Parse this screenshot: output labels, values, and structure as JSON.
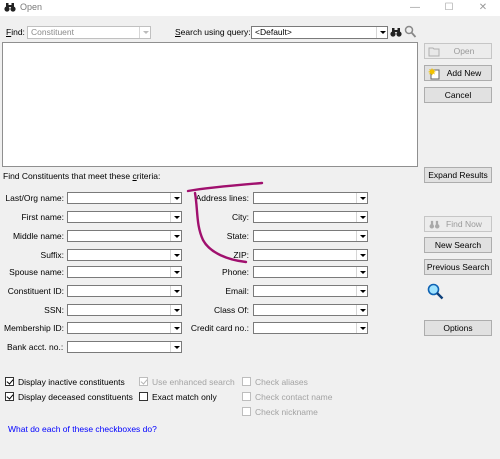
{
  "window": {
    "title": "Open"
  },
  "find": {
    "label": "Find:",
    "value": "Constituent"
  },
  "query": {
    "label": "Search using query:",
    "value": "<Default>"
  },
  "buttons": {
    "open": "Open",
    "add_new": "Add New",
    "cancel": "Cancel",
    "expand_results": "Expand Results",
    "find_now": "Find Now",
    "new_search": "New Search",
    "previous_search": "Previous Search",
    "options": "Options"
  },
  "criteria_heading": "Find Constituents that meet these criteria:",
  "left_fields": [
    {
      "label": "Last/Org name:"
    },
    {
      "label": "First name:"
    },
    {
      "label": "Middle name:"
    },
    {
      "label": "Suffix:"
    },
    {
      "label": "Spouse name:"
    },
    {
      "label": "Constituent ID:"
    },
    {
      "label": "SSN:"
    },
    {
      "label": "Membership ID:"
    },
    {
      "label": "Bank acct. no.:"
    }
  ],
  "right_fields": [
    {
      "label": "Address lines:"
    },
    {
      "label": "City:"
    },
    {
      "label": "State:"
    },
    {
      "label": "ZIP:"
    },
    {
      "label": "Phone:"
    },
    {
      "label": "Email:"
    },
    {
      "label": "Class Of:"
    },
    {
      "label": "Credit card no.:"
    }
  ],
  "checkboxes": {
    "inactive": {
      "label": "Display inactive constituents",
      "checked": true
    },
    "deceased": {
      "label": "Display deceased constituents",
      "checked": true
    },
    "enhanced": {
      "label": "Use enhanced search",
      "checked": true,
      "disabled": true
    },
    "exact": {
      "label": "Exact match only",
      "checked": false
    },
    "aliases": {
      "label": "Check aliases",
      "checked": false,
      "disabled": true
    },
    "contact": {
      "label": "Check contact name",
      "checked": false,
      "disabled": true
    },
    "nickname": {
      "label": "Check nickname",
      "checked": false,
      "disabled": true
    }
  },
  "help_link": "What do each of these checkboxes do?",
  "colors": {
    "link": "#0000ff",
    "annotation": "#a0106e",
    "window_bg": "#f0f0f0"
  }
}
